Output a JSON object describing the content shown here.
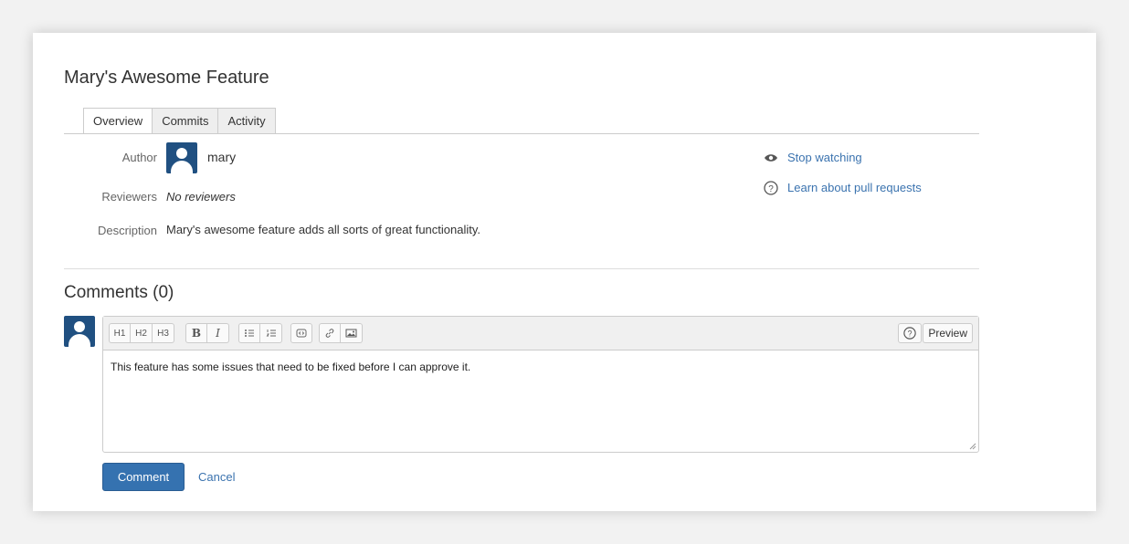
{
  "pull_request": {
    "title": "Mary's Awesome Feature"
  },
  "tabs": [
    {
      "label": "Overview",
      "active": true
    },
    {
      "label": "Commits",
      "active": false
    },
    {
      "label": "Activity",
      "active": false
    }
  ],
  "details": {
    "author_label": "Author",
    "author_name": "mary",
    "reviewers_label": "Reviewers",
    "reviewers_value": "No reviewers",
    "description_label": "Description",
    "description_value": "Mary's awesome feature adds all sorts of great functionality."
  },
  "side_links": {
    "watch": "Stop watching",
    "learn": "Learn about pull requests"
  },
  "comments": {
    "heading": "Comments (0)",
    "draft_text": "This feature has some issues that need to be fixed before I can approve it.",
    "toolbar": {
      "heading_buttons": [
        "H1",
        "H2",
        "H3"
      ],
      "format_buttons": [
        "B",
        "I"
      ],
      "preview_label": "Preview"
    },
    "submit_label": "Comment",
    "cancel_label": "Cancel"
  },
  "colors": {
    "accent": "#3572b0",
    "link": "#3b73af",
    "avatar": "#205081"
  }
}
